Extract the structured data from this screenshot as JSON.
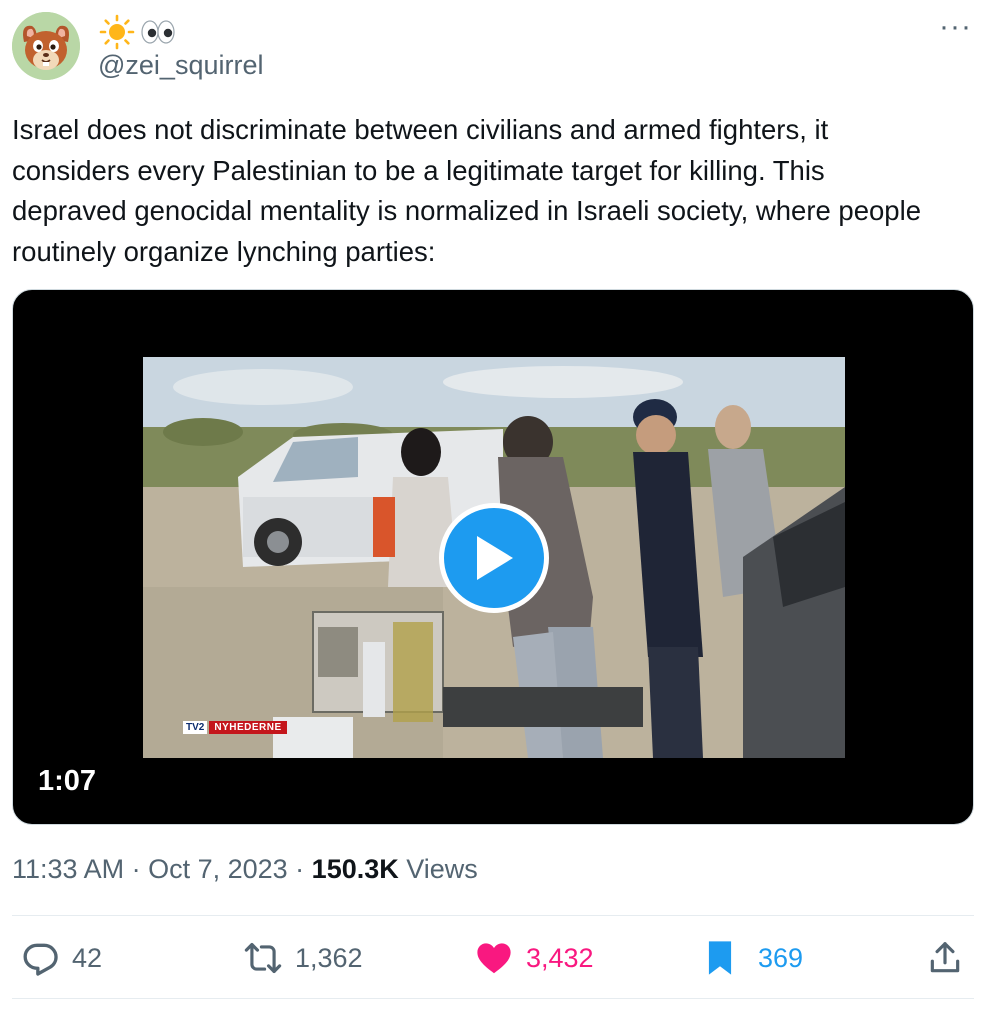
{
  "user": {
    "display_emojis": "☀️👀",
    "handle": "@zei_squirrel"
  },
  "more_label": "···",
  "tweet_text": "Israel does not discriminate between civilians and armed fighters, it considers every Palestinian to be a legitimate target for killing. This depraved genocidal mentality is normalized in Israeli society, where people routinely organize lynching parties:",
  "media": {
    "duration": "1:07",
    "watermark_box": "TV2",
    "watermark_label": "NYHEDERNE"
  },
  "meta": {
    "time": "11:33 AM",
    "date": "Oct 7, 2023",
    "views_count": "150.3K",
    "views_label": "Views",
    "separator": " · "
  },
  "actions": {
    "replies": "42",
    "retweets": "1,362",
    "likes": "3,432",
    "bookmarks": "369"
  },
  "colors": {
    "like": "#f91880",
    "bookmark": "#1d9bf0",
    "play": "#1d9bf0",
    "secondary_text": "#536471"
  }
}
